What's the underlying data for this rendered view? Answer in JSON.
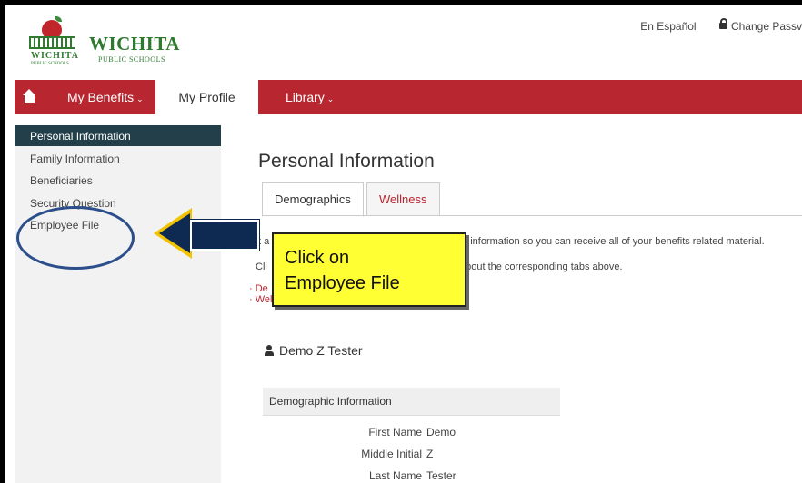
{
  "brand": {
    "name": "WICHITA",
    "subtitle": "PUBLIC SCHOOLS",
    "logo_small_name": "WICHITA",
    "logo_small_sub": "PUBLIC SCHOOLS"
  },
  "top_links": {
    "spanish": "En Español",
    "change_password": "Change Passv"
  },
  "nav": {
    "items": [
      {
        "label": "My Benefits",
        "caret": "⌄"
      },
      {
        "label": "My Profile"
      },
      {
        "label": "Library",
        "caret": "⌄"
      }
    ]
  },
  "sidebar": {
    "items": [
      {
        "label": "Personal Information",
        "active": true
      },
      {
        "label": "Family Information"
      },
      {
        "label": "Beneficiaries"
      },
      {
        "label": "Security Question"
      },
      {
        "label": "Employee File"
      }
    ]
  },
  "annotation": {
    "callout_text": "Click on\nEmployee File"
  },
  "main": {
    "title": "Personal Information",
    "tabs": [
      {
        "label": "Demographics",
        "active": true
      },
      {
        "label": "Wellness"
      }
    ],
    "intro_line1_start": "It a",
    "intro_line1_end": "te information so you can receive all of your benefits related material.",
    "intro_line2_start": "Cli",
    "intro_line2_end": "about the corresponding tabs above.",
    "links": [
      "· De",
      "· Wellness"
    ],
    "person_name": "Demo Z Tester"
  },
  "demographics": {
    "header": "Demographic Information",
    "rows": [
      {
        "label": "First Name",
        "value": "Demo"
      },
      {
        "label": "Middle Initial",
        "value": "Z"
      },
      {
        "label": "Last Name",
        "value": "Tester"
      }
    ]
  },
  "colors": {
    "brand_red": "#b8262f",
    "sidebar_active": "#23404a",
    "logo_green": "#2f7a2f",
    "callout_yellow": "#ffff33",
    "arrow_navy": "#0f2a52"
  }
}
